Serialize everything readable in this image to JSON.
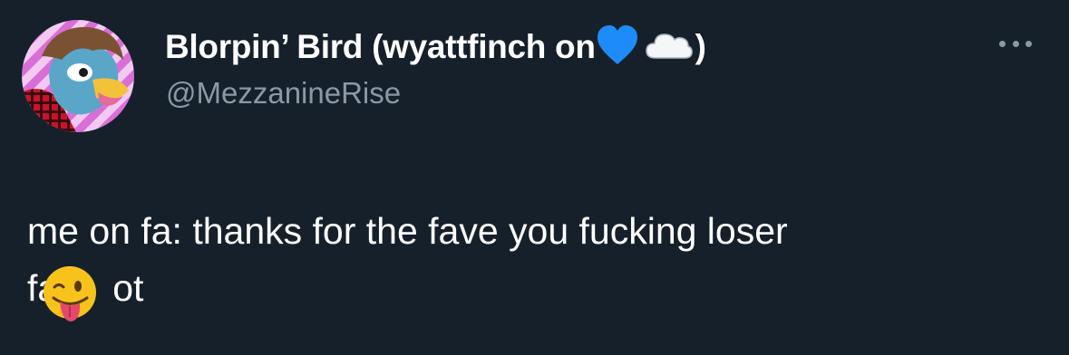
{
  "author": {
    "name": "Blorpin’ Bird (wyattfinch on",
    "name_suffix": ")",
    "handle": "@MezzanineRise",
    "name_emojis": [
      "blue-heart",
      "cloud"
    ]
  },
  "tweet": {
    "line1": "me on fa: thanks for the fave you fucking loser",
    "line2_start": "fa",
    "line2_end": "ot",
    "inline_emoji": "winking-face-with-tongue"
  },
  "colors": {
    "background": "#15202b",
    "text_primary": "#ffffff",
    "text_secondary": "#8b98a5",
    "heart": "#1d8cf8"
  }
}
